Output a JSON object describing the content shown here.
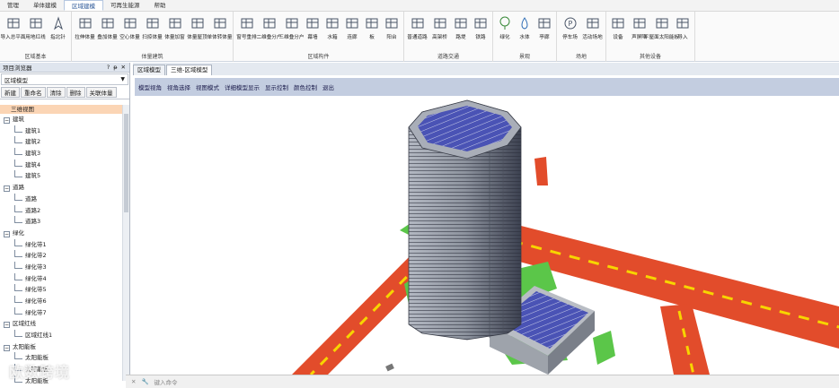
{
  "menu": {
    "tabs": [
      "管理",
      "单体建模",
      "区域建模",
      "可再生能源",
      "帮助"
    ],
    "active_index": 2
  },
  "ribbon": {
    "groups": [
      {
        "label": "区域基本",
        "buttons": [
          {
            "label": "导入总平面",
            "icon": "import-plan-icon"
          },
          {
            "label": "用地红线",
            "icon": "redline-icon"
          },
          {
            "label": "指北针",
            "icon": "north-arrow-icon"
          }
        ]
      },
      {
        "label": "体量建筑",
        "buttons": [
          {
            "label": "拉伸体量",
            "icon": "extrude-icon"
          },
          {
            "label": "叠加体量",
            "icon": "stack-icon"
          },
          {
            "label": "空心体量",
            "icon": "hollow-icon"
          },
          {
            "label": "扫掠体量",
            "icon": "sweep-icon"
          },
          {
            "label": "体量加窗",
            "icon": "window-icon"
          },
          {
            "label": "体量屋顶",
            "icon": "roof-icon"
          },
          {
            "label": "单体转体量",
            "icon": "convert-icon"
          }
        ]
      },
      {
        "label": "区域构件",
        "buttons": [
          {
            "label": "窗号重排",
            "icon": "window-number-icon"
          },
          {
            "label": "二维叠分户",
            "icon": "split-2d-icon"
          },
          {
            "label": "三维叠分户",
            "icon": "split-3d-icon"
          },
          {
            "label": "幕墙",
            "icon": "curtain-wall-icon"
          },
          {
            "label": "水箱",
            "icon": "water-tank-icon"
          },
          {
            "label": "连廊",
            "icon": "corridor-icon"
          },
          {
            "label": "板",
            "icon": "slab-icon"
          },
          {
            "label": "阳台",
            "icon": "balcony-icon"
          }
        ]
      },
      {
        "label": "道路交通",
        "buttons": [
          {
            "label": "普通道路",
            "icon": "road-icon"
          },
          {
            "label": "高架桥",
            "icon": "viaduct-icon"
          },
          {
            "label": "路堤",
            "icon": "embankment-icon"
          },
          {
            "label": "铁路",
            "icon": "railway-icon"
          }
        ]
      },
      {
        "label": "景观",
        "buttons": [
          {
            "label": "绿化",
            "icon": "greenery-icon"
          },
          {
            "label": "水体",
            "icon": "water-icon"
          },
          {
            "label": "亭廊",
            "icon": "pavilion-icon"
          }
        ]
      },
      {
        "label": "场地",
        "buttons": [
          {
            "label": "停车场",
            "icon": "parking-icon"
          },
          {
            "label": "活动场地",
            "icon": "activity-site-icon"
          }
        ]
      },
      {
        "label": "其他设备",
        "buttons": [
          {
            "label": "设备",
            "icon": "equipment-icon"
          },
          {
            "label": "声屏障",
            "icon": "sound-barrier-icon"
          },
          {
            "label": "平屋面太阳能板",
            "icon": "solar-panel-icon"
          },
          {
            "label": "导入",
            "icon": "import-icon"
          }
        ]
      }
    ]
  },
  "panel": {
    "title": "项目浏览器",
    "controls": [
      "?",
      "ᵽ",
      "✕"
    ],
    "view_select": "区域模型",
    "tools": [
      "新建",
      "重命名",
      "清除",
      "删除",
      "关联体量"
    ],
    "selected": "三维视图",
    "tree": [
      {
        "label": "建筑",
        "children": [
          "建筑1",
          "建筑2",
          "建筑3",
          "建筑4",
          "建筑5"
        ]
      },
      {
        "label": "道路",
        "children": [
          "道路",
          "道路2",
          "道路3"
        ]
      },
      {
        "label": "绿化",
        "children": [
          "绿化带1",
          "绿化带2",
          "绿化带3",
          "绿化带4",
          "绿化带5",
          "绿化带6",
          "绿化带7"
        ]
      },
      {
        "label": "区域红线",
        "children": [
          "区域红线1"
        ]
      },
      {
        "label": "太阳能板",
        "children": [
          "太阳能板",
          "太阳能板",
          "太阳能板"
        ]
      }
    ]
  },
  "doc_tabs": [
    "区域模型",
    "三维-区域模型"
  ],
  "doc_tab_active": 1,
  "view_toolbar": [
    "模型视角",
    "视角选择",
    "视图模式",
    "详细模型显示",
    "显示控制",
    "颜色控制",
    "退出"
  ],
  "cmdline": {
    "placeholder": "键入命令"
  },
  "watermark": "欧数跨境",
  "colors": {
    "road": "#e8502e",
    "road_marking": "#f5d400",
    "grass": "#5cc64a",
    "solar": "#4f57b8",
    "building": "#9aa0aa"
  }
}
